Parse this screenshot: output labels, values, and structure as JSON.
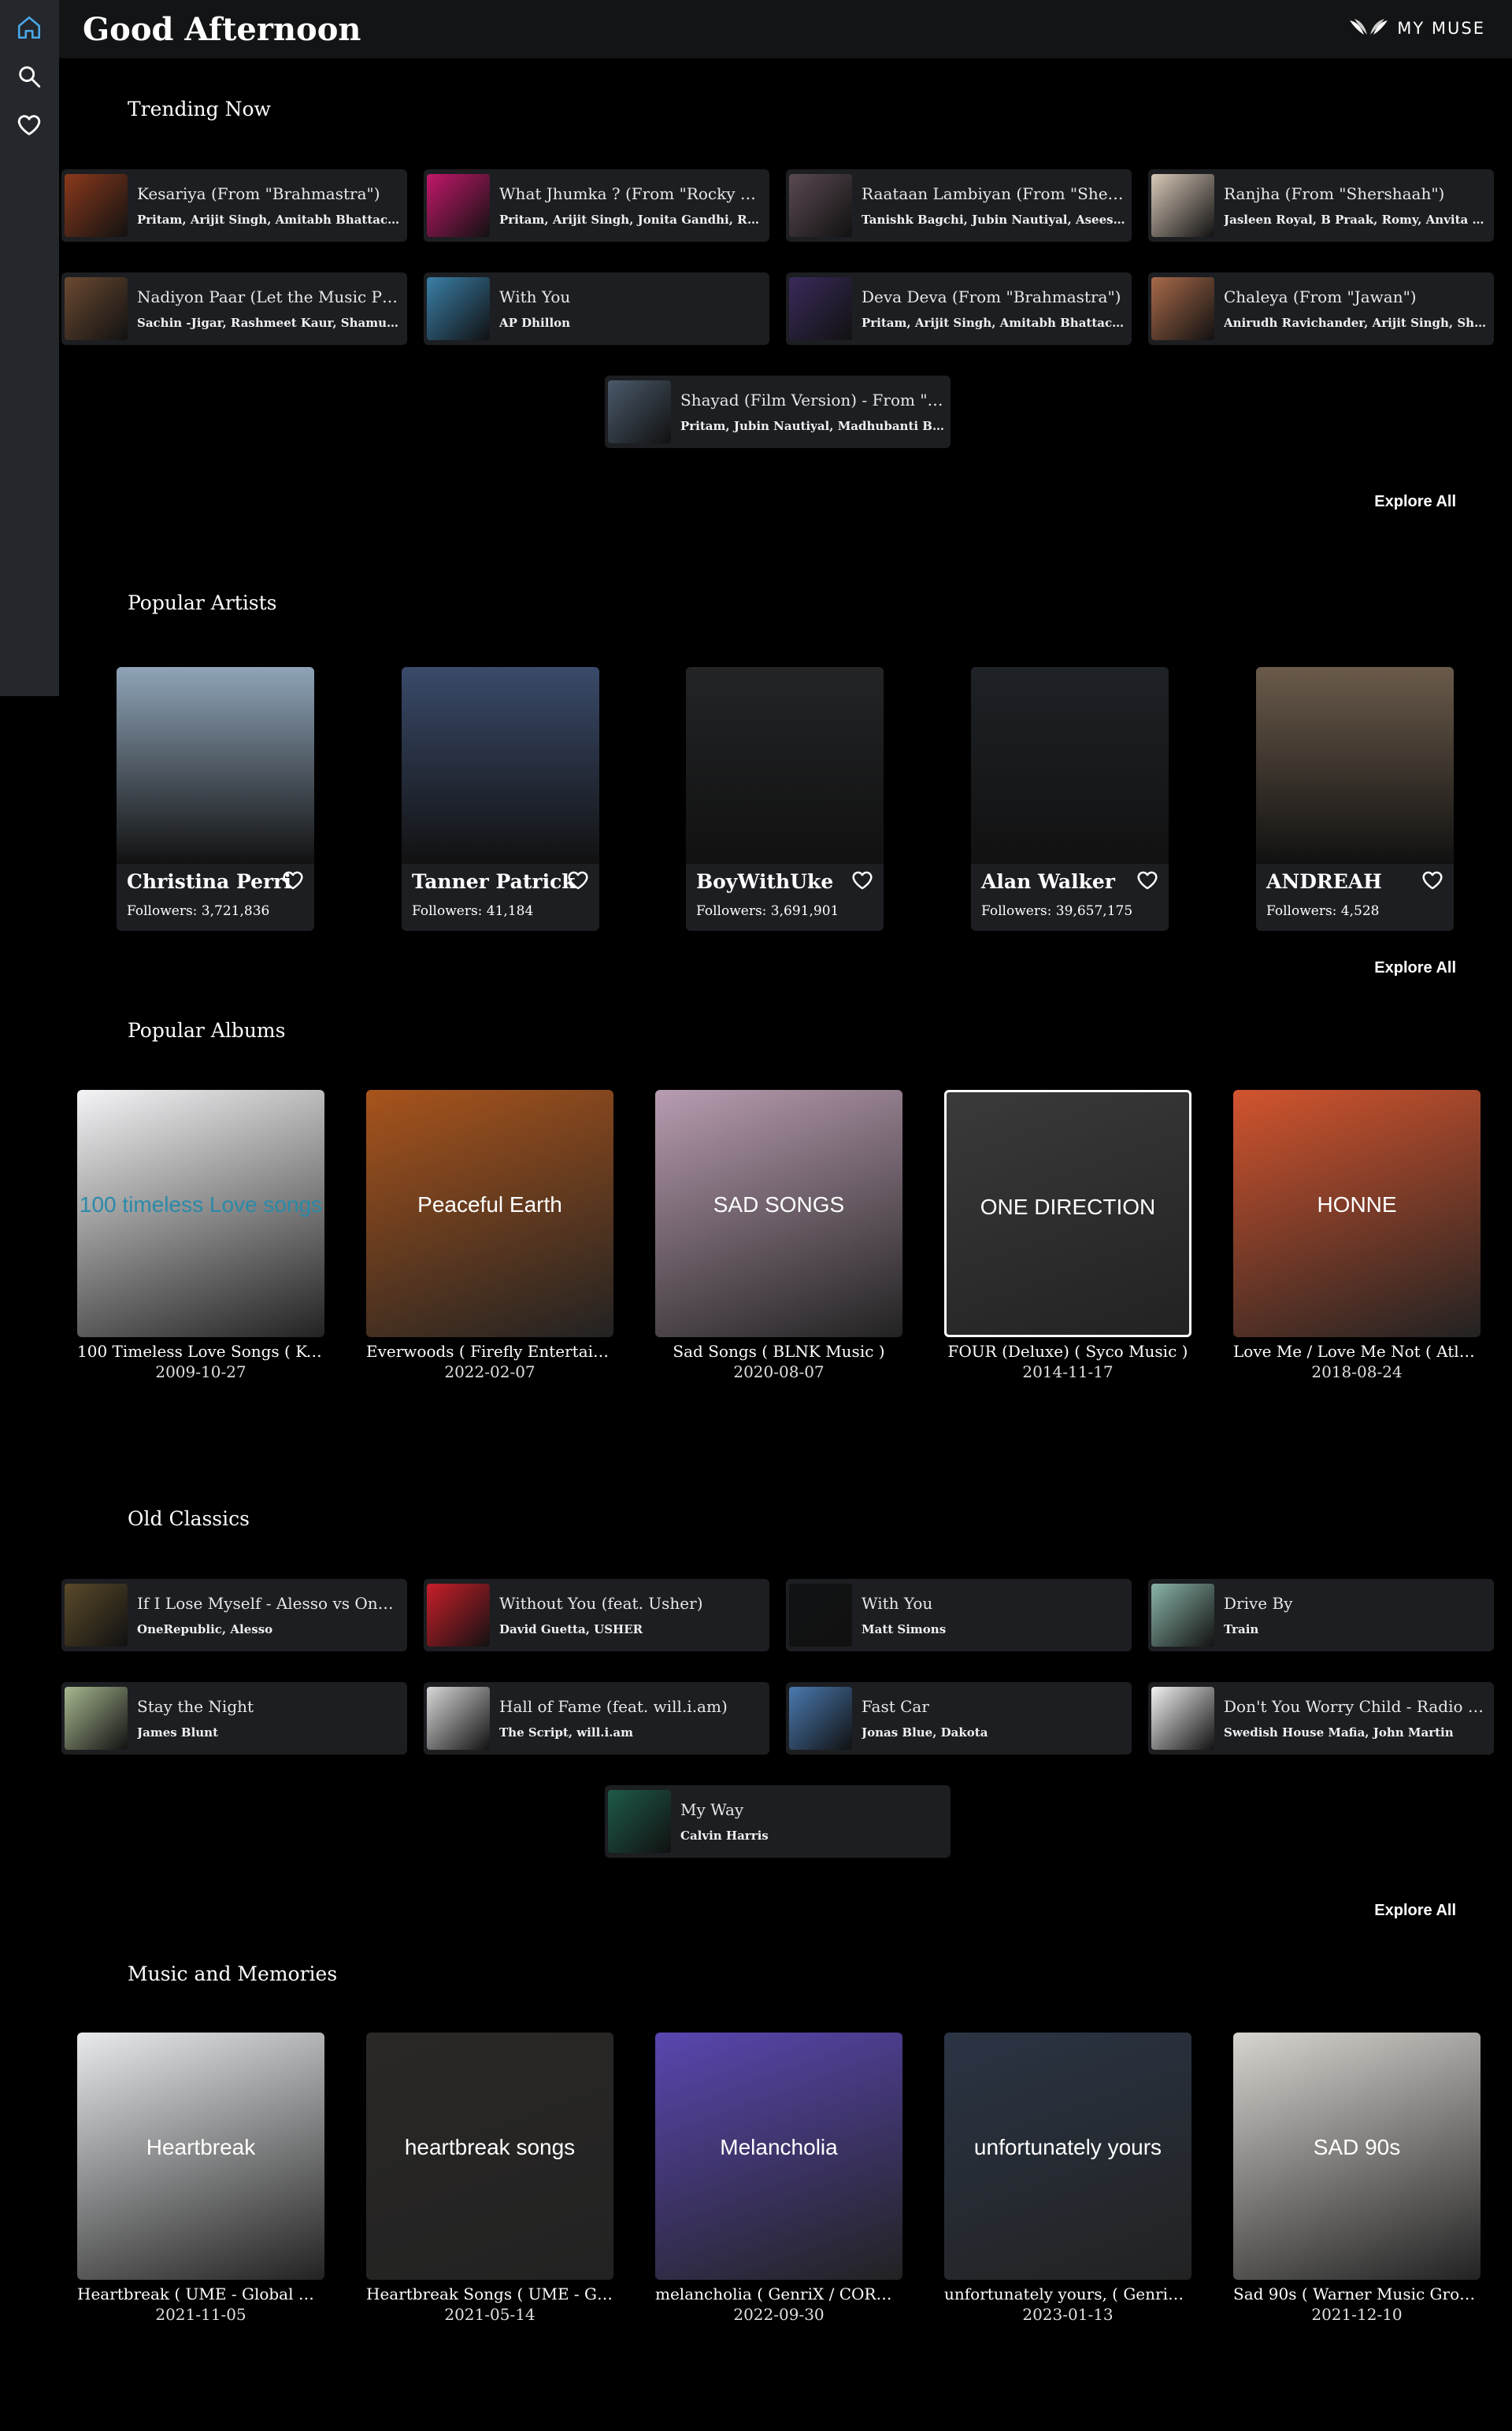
{
  "header": {
    "greeting": "Good Afternoon",
    "logo_text": "MY MUSE"
  },
  "sidebar": {
    "items": [
      {
        "icon": "home-icon"
      },
      {
        "icon": "search-icon"
      },
      {
        "icon": "heart-icon"
      }
    ]
  },
  "trending": {
    "title": "Trending Now",
    "explore": "Explore All",
    "songs": [
      {
        "title": "Kesariya (From \"Brahmastra\")",
        "artists": "Pritam, Arijit Singh, Amitabh Bhattacharya",
        "color": "#8a3a1c"
      },
      {
        "title": "What Jhumka ? (From \"Rocky A...",
        "artists": "Pritam, Arijit Singh, Jonita Gandhi, Ranveer...",
        "color": "#c2186a"
      },
      {
        "title": "Raataan Lambiyan (From \"Shers...",
        "artists": "Tanishk Bagchi, Jubin Nautiyal, Asees Kaur",
        "color": "#5a4a52"
      },
      {
        "title": "Ranjha (From \"Shershaah\")",
        "artists": "Jasleen Royal, B Praak, Romy, Anvita Dutt",
        "color": "#d8c8b8"
      },
      {
        "title": "Nadiyon Paar (Let the Music Pla...",
        "artists": "Sachin -Jigar, Rashmeet Kaur, Shamur, IP Si...",
        "color": "#6b4a32"
      },
      {
        "title": "With You",
        "artists": "AP Dhillon",
        "color": "#3a7fa8"
      },
      {
        "title": "Deva Deva (From \"Brahmastra\")",
        "artists": "Pritam, Arijit Singh, Amitabh Bhattacharya,...",
        "color": "#3a2a5a"
      },
      {
        "title": "Chaleya (From \"Jawan\")",
        "artists": "Anirudh Ravichander, Arijit Singh, Shilpa R...",
        "color": "#a86a4a"
      },
      {
        "title": "Shayad (Film Version) - From \"L...",
        "artists": "Pritam, Jubin Nautiyal, Madhubanti Bagchi",
        "color": "#4a5a6a"
      }
    ]
  },
  "artists": {
    "title": "Popular Artists",
    "explore": "Explore All",
    "items": [
      {
        "name": "Christina Perri",
        "followers": "Followers: 3,721,836",
        "color": "#8fa4b8"
      },
      {
        "name": "Tanner Patrick",
        "followers": "Followers: 41,184",
        "color": "#3a4a6a"
      },
      {
        "name": "BoyWithUke",
        "followers": "Followers: 3,691,901",
        "color": "#222426"
      },
      {
        "name": "Alan Walker",
        "followers": "Followers: 39,657,175",
        "color": "#1e2226"
      },
      {
        "name": "ANDREAH",
        "followers": "Followers: 4,528",
        "color": "#6a5a4a"
      }
    ]
  },
  "albums": {
    "title": "Popular Albums",
    "items": [
      {
        "name": "100 Timeless Love Songs ( K-Tel )",
        "date": "2009-10-27",
        "art_text": "100 timeless Love songs",
        "color": "#f4f4f6"
      },
      {
        "name": "Everwoods ( Firefly Entertainm...",
        "date": "2022-02-07",
        "art_text": "Peaceful Earth",
        "color": "#a8541c"
      },
      {
        "name": "Sad Songs ( BLNK Music )",
        "date": "2020-08-07",
        "art_text": "SAD SONGS",
        "color": "#b89cb0"
      },
      {
        "name": "FOUR (Deluxe) ( Syco Music )",
        "date": "2014-11-17",
        "art_text": "ONE DIRECTION",
        "color": "#3a3a3a"
      },
      {
        "name": "Love Me / Love Me Not ( Atlanti...",
        "date": "2018-08-24",
        "art_text": "HONNE",
        "color": "#d2542e"
      }
    ]
  },
  "classics": {
    "title": "Old Classics",
    "explore": "Explore All",
    "songs": [
      {
        "title": "If I Lose Myself - Alesso vs OneR...",
        "artists": "OneRepublic, Alesso",
        "color": "#5a4a2a"
      },
      {
        "title": "Without You (feat. Usher)",
        "artists": "David Guetta, USHER",
        "color": "#c81e2a"
      },
      {
        "title": "With You",
        "artists": "Matt Simons",
        "color": "#111214"
      },
      {
        "title": "Drive By",
        "artists": "Train",
        "color": "#8ab4a8"
      },
      {
        "title": "Stay the Night",
        "artists": "James Blunt",
        "color": "#a8b890"
      },
      {
        "title": "Hall of Fame (feat. will.i.am)",
        "artists": "The Script, will.i.am",
        "color": "#d8d8d8"
      },
      {
        "title": "Fast Car",
        "artists": "Jonas Blue, Dakota",
        "color": "#4a7ab0"
      },
      {
        "title": "Don't You Worry Child - Radio Ed...",
        "artists": "Swedish House Mafia, John Martin",
        "color": "#f2f2f2"
      },
      {
        "title": "My Way",
        "artists": "Calvin Harris",
        "color": "#1e5a4a"
      }
    ]
  },
  "memories": {
    "title": "Music and Memories",
    "items": [
      {
        "name": "Heartbreak ( UME - Global Clea...",
        "date": "2021-11-05",
        "art_text": "Heartbreak",
        "color": "#e8eaec"
      },
      {
        "name": "Heartbreak Songs ( UME - Glob...",
        "date": "2021-05-14",
        "art_text": "heartbreak songs",
        "color": "#2a2826"
      },
      {
        "name": "melancholia ( GenriX / CORBAL )",
        "date": "2022-09-30",
        "art_text": "Melancholia",
        "color": "#5a46b0"
      },
      {
        "name": "unfortunately yours, ( GenriX / ...",
        "date": "2023-01-13",
        "art_text": "unfortunately yours",
        "color": "#2a3444"
      },
      {
        "name": "Sad 90s ( Warner Music Group -...",
        "date": "2021-12-10",
        "art_text": "SAD 90s",
        "color": "#d8d4d0"
      }
    ]
  }
}
